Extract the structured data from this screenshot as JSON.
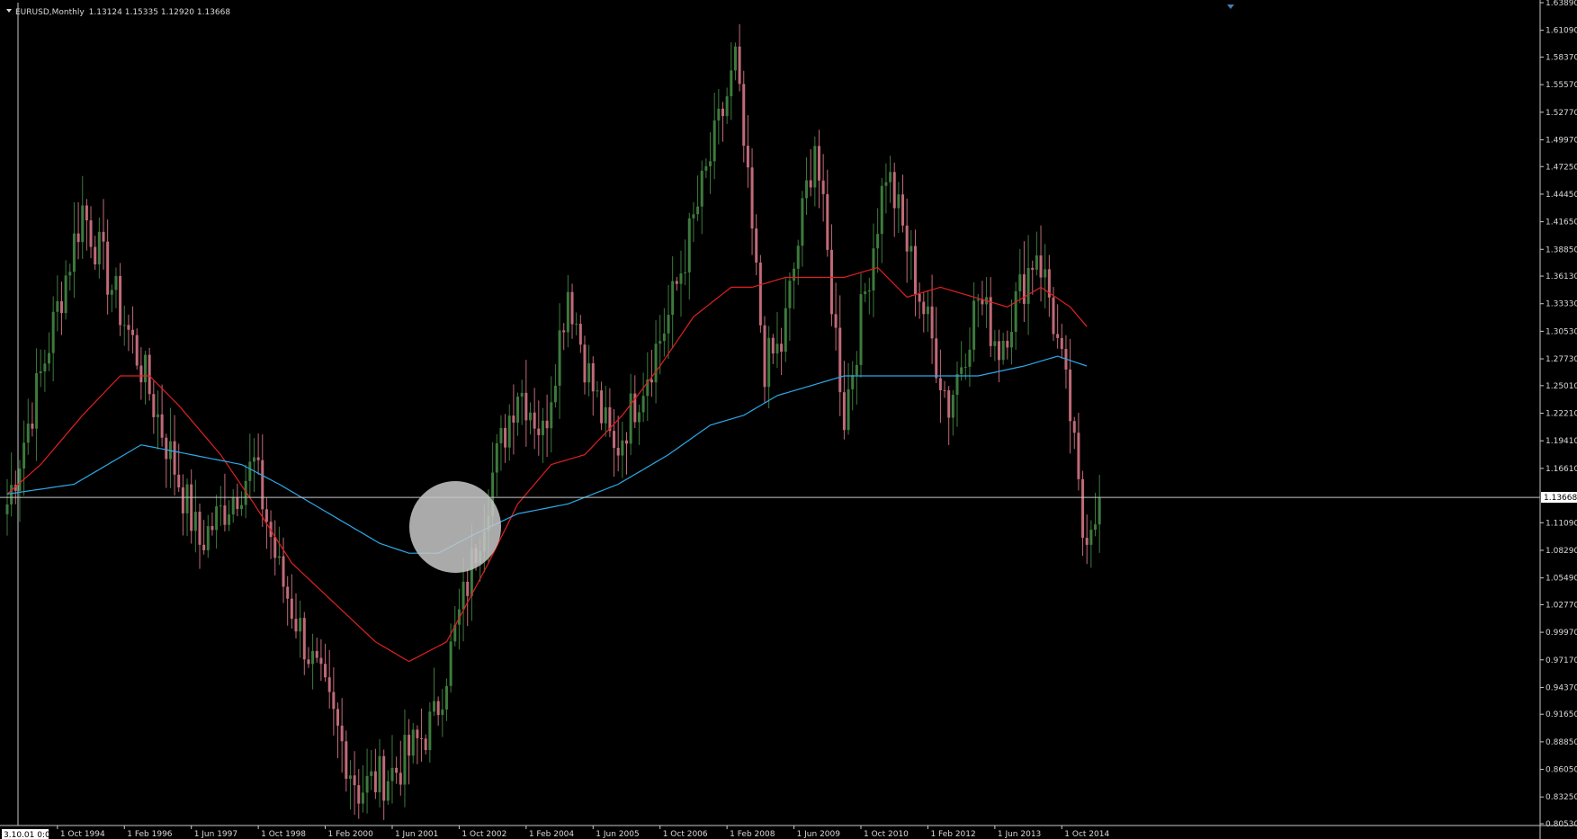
{
  "header": {
    "symbol": "EURUSD,Monthly",
    "ohlc": "1.13124 1.15335 1.12920 1.13668"
  },
  "current_price_label": "1.13668",
  "current_price": 1.13668,
  "start_time_label": "3.10.01 0:00",
  "colors": {
    "background": "#000000",
    "bull_candle": "#3d7a3d",
    "bear_candle": "#c06a78",
    "ma_fast": "#e02020",
    "ma_slow": "#2ea8e8",
    "price_line": "#c8c8c8",
    "axis_text": "#d8d8d8",
    "highlight_circle": "#c8c8c8"
  },
  "chart_data": {
    "type": "line",
    "title": "EURUSD,Monthly",
    "xlabel": "",
    "ylabel": "",
    "ylim": [
      0.8035,
      1.6389
    ],
    "grid": false,
    "y_ticks": [
      "1.63890",
      "1.61090",
      "1.58370",
      "1.55570",
      "1.52770",
      "1.49970",
      "1.47250",
      "1.44450",
      "1.41650",
      "1.38850",
      "1.36130",
      "1.33330",
      "1.30530",
      "1.27730",
      "1.25010",
      "1.22210",
      "1.19410",
      "1.16610",
      "1.13668",
      "1.11090",
      "1.08290",
      "1.05490",
      "1.02770",
      "0.99970",
      "0.97170",
      "0.94370",
      "0.91650",
      "0.88850",
      "0.86050",
      "0.83250",
      "0.80530"
    ],
    "x_tick_labels": [
      "1 Oct 1994",
      "1 Feb 1996",
      "1 Jun 1997",
      "1 Oct 1998",
      "1 Feb 2000",
      "1 Jun 2001",
      "1 Oct 2002",
      "1 Feb 2004",
      "1 Jun 2005",
      "1 Oct 2006",
      "1 Feb 2008",
      "1 Jun 2009",
      "1 Oct 2010",
      "1 Feb 2012",
      "1 Jun 2013",
      "1 Oct 2014"
    ],
    "price_anchors": {
      "x": [
        "1993-10",
        "1994-06",
        "1995-04",
        "1996-06",
        "1997-08",
        "1998-09",
        "1999-03",
        "2000-10",
        "2001-07",
        "2002-04",
        "2002-12",
        "2003-06",
        "2003-12",
        "2004-03",
        "2004-06",
        "2004-12",
        "2005-05",
        "2005-11",
        "2006-12",
        "2008-03",
        "2008-04",
        "2008-11",
        "2009-03",
        "2009-11",
        "2010-06",
        "2011-04",
        "2011-06",
        "2012-07",
        "2013-02",
        "2013-07",
        "2014-04",
        "2014-07",
        "2014-12",
        "2015-03",
        "2015-07"
      ],
      "values": [
        1.13,
        1.26,
        1.43,
        1.27,
        1.09,
        1.17,
        1.06,
        0.84,
        0.86,
        0.91,
        1.05,
        1.16,
        1.25,
        1.23,
        1.2,
        1.35,
        1.26,
        1.18,
        1.32,
        1.56,
        1.58,
        1.27,
        1.29,
        1.5,
        1.22,
        1.47,
        1.44,
        1.23,
        1.34,
        1.29,
        1.39,
        1.34,
        1.22,
        1.1,
        1.13668
      ]
    },
    "series": [
      {
        "name": "",
        "color": "#e02020",
        "x": [
          "1993-10",
          "1994-06",
          "1995-04",
          "1996-01",
          "1996-08",
          "1997-03",
          "1998-01",
          "1998-09",
          "1999-06",
          "2000-04",
          "2001-02",
          "2001-10",
          "2002-07",
          "2003-05",
          "2003-12",
          "2004-08",
          "2005-04",
          "2006-01",
          "2006-10",
          "2007-06",
          "2008-03",
          "2008-08",
          "2009-04",
          "2009-11",
          "2010-06",
          "2011-02",
          "2011-09",
          "2012-05",
          "2013-01",
          "2013-09",
          "2014-05",
          "2014-12",
          "2015-04"
        ],
        "values": [
          1.14,
          1.17,
          1.22,
          1.26,
          1.26,
          1.23,
          1.18,
          1.13,
          1.07,
          1.03,
          0.99,
          0.97,
          0.99,
          1.07,
          1.13,
          1.17,
          1.18,
          1.22,
          1.27,
          1.32,
          1.35,
          1.35,
          1.36,
          1.36,
          1.36,
          1.37,
          1.34,
          1.35,
          1.34,
          1.33,
          1.35,
          1.33,
          1.31
        ]
      },
      {
        "name": "",
        "color": "#2ea8e8",
        "x": [
          "1993-10",
          "1995-02",
          "1996-06",
          "1997-06",
          "1998-06",
          "1999-03",
          "2000-03",
          "2001-03",
          "2001-10",
          "2002-05",
          "2003-02",
          "2003-12",
          "2004-12",
          "2005-12",
          "2006-12",
          "2007-10",
          "2008-06",
          "2009-02",
          "2009-10",
          "2010-06",
          "2011-02",
          "2011-10",
          "2012-06",
          "2013-02",
          "2014-01",
          "2014-09",
          "2015-04"
        ],
        "values": [
          1.14,
          1.15,
          1.19,
          1.18,
          1.17,
          1.15,
          1.12,
          1.09,
          1.08,
          1.08,
          1.1,
          1.12,
          1.13,
          1.15,
          1.18,
          1.21,
          1.22,
          1.24,
          1.25,
          1.26,
          1.26,
          1.26,
          1.26,
          1.26,
          1.27,
          1.28,
          1.27
        ]
      }
    ]
  }
}
